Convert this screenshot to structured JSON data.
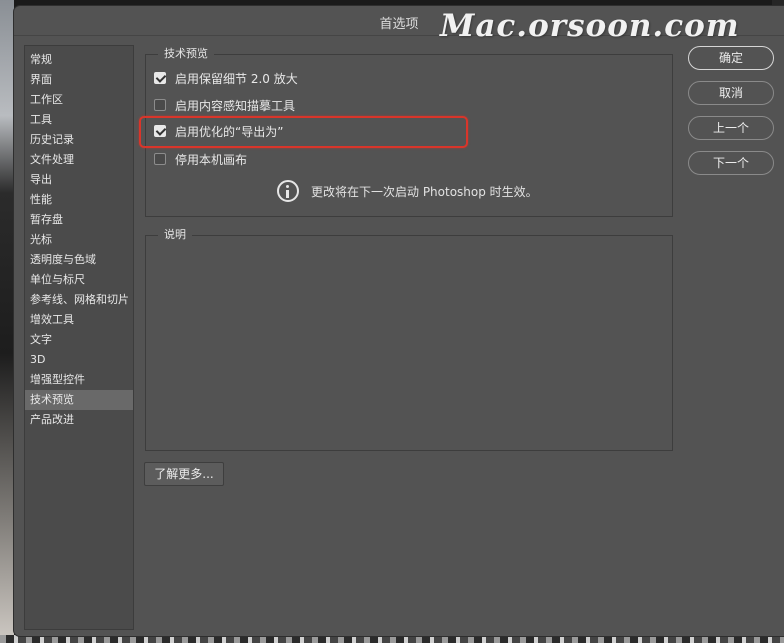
{
  "window": {
    "title": "首选项",
    "watermark": "Mac.orsoon.com"
  },
  "sidebar": {
    "items": [
      {
        "label": "常规"
      },
      {
        "label": "界面"
      },
      {
        "label": "工作区"
      },
      {
        "label": "工具"
      },
      {
        "label": "历史记录"
      },
      {
        "label": "文件处理"
      },
      {
        "label": "导出"
      },
      {
        "label": "性能"
      },
      {
        "label": "暂存盘"
      },
      {
        "label": "光标"
      },
      {
        "label": "透明度与色域"
      },
      {
        "label": "单位与标尺"
      },
      {
        "label": "参考线、网格和切片"
      },
      {
        "label": "增效工具"
      },
      {
        "label": "文字"
      },
      {
        "label": "3D"
      },
      {
        "label": "增强型控件"
      },
      {
        "label": "技术预览",
        "selected": true
      },
      {
        "label": "产品改进"
      }
    ]
  },
  "preview_group": {
    "legend": "技术预览",
    "options": [
      {
        "label": "启用保留细节 2.0 放大",
        "checked": true
      },
      {
        "label": "启用内容感知描摹工具",
        "checked": false
      },
      {
        "label": "启用优化的“导出为”",
        "checked": true,
        "highlighted": true
      },
      {
        "label": "停用本机画布",
        "checked": false
      }
    ],
    "info_text": "更改将在下一次启动 Photoshop 时生效。"
  },
  "description_group": {
    "legend": "说明"
  },
  "buttons": {
    "ok": "确定",
    "cancel": "取消",
    "prev": "上一个",
    "next": "下一个",
    "learn_more": "了解更多..."
  },
  "colors": {
    "dialog_bg": "#535353",
    "highlight": "#d9352a"
  }
}
